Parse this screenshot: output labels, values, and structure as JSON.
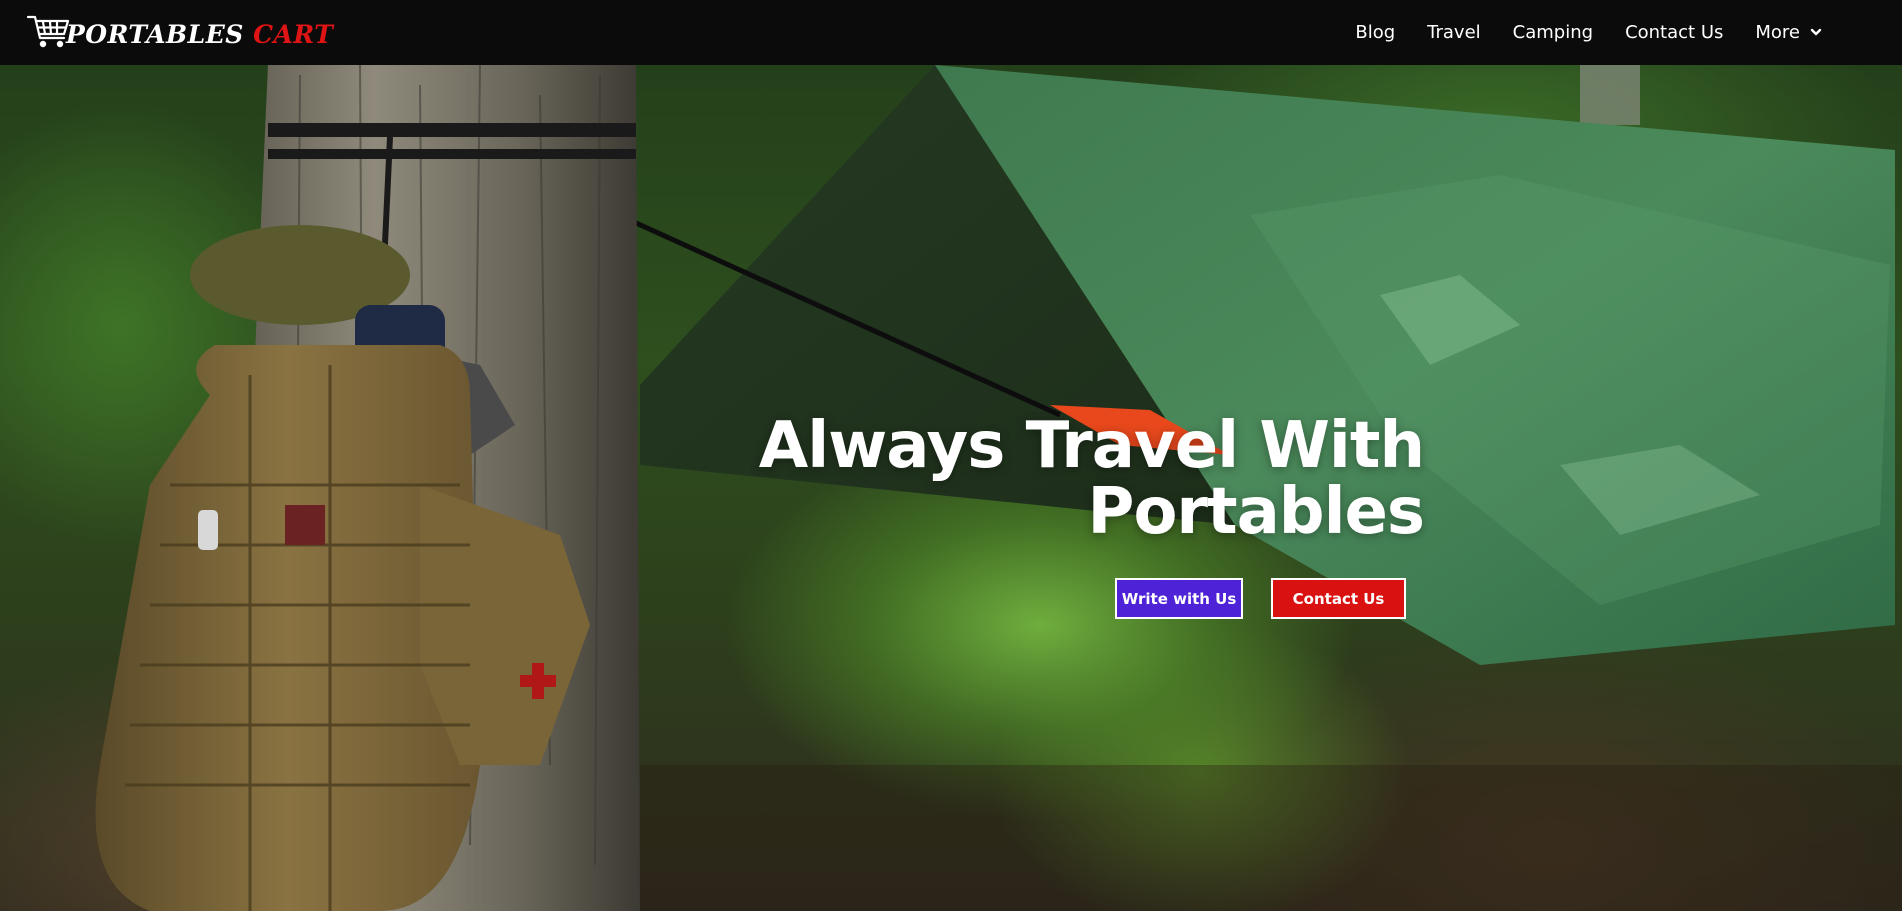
{
  "header": {
    "logo": {
      "word1": "PORTABLES",
      "word2": "CART",
      "icon": "shopping-cart-icon",
      "word1_color": "#ffffff",
      "word2_color": "#e01414"
    },
    "nav": [
      {
        "label": "Blog"
      },
      {
        "label": "Travel"
      },
      {
        "label": "Camping"
      },
      {
        "label": "Contact Us"
      },
      {
        "label": "More",
        "icon": "chevron-down-icon"
      }
    ]
  },
  "hero": {
    "title_line1": "Always Travel With",
    "title_line2": "Portables",
    "buttons": {
      "write": "Write with Us",
      "contact": "Contact Us"
    },
    "colors": {
      "write_button": "#4e22d6",
      "contact_button": "#d91111",
      "header_bg": "#0b0b0b"
    }
  }
}
